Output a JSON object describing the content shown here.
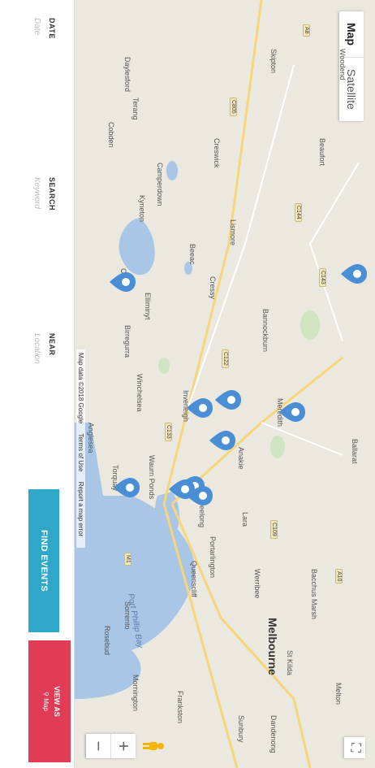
{
  "map": {
    "map_type_tabs": [
      "Map",
      "Satellite"
    ],
    "attribution": [
      "Map data ©2018 Google",
      "Terms of Use",
      "Report a map error"
    ],
    "zoom_in": "+",
    "zoom_out": "−",
    "fullscreen": "⛶",
    "city": "Melbourne",
    "bay": "Port Phillip Bay",
    "places": [
      "Woodend",
      "Daylesford",
      "Kyneton",
      "Creswick",
      "Ballarat",
      "Bacchus Marsh",
      "Melton",
      "Sunbury",
      "Meredith",
      "Geelong",
      "Werribee",
      "Torquay",
      "Anglesea",
      "Winchelsea",
      "Colac",
      "Lara",
      "Queenscliff",
      "Sorrento",
      "Rosebud",
      "Frankston",
      "Mornington",
      "Dandenong",
      "St Kilda",
      "Inverleigh",
      "Anakie",
      "Skipton",
      "Beaufort",
      "Lismore",
      "Cressy",
      "Bannockburn",
      "Camperdown",
      "Cobden",
      "Terang",
      "Elliminyt",
      "Beeac",
      "Birregurra",
      "Waurn Ponds",
      "Portarlington"
    ],
    "pegman": "pegman-icon"
  },
  "search_bar": {
    "date_label": "DATE",
    "date_placeholder": "Date",
    "search_label": "SEARCH",
    "search_placeholder": "Keyword",
    "near_label": "NEAR",
    "near_placeholder": "Location",
    "find_button": "FIND EVENTS",
    "view_as_label": "VIEW AS",
    "view_as_value": "Map"
  },
  "colors": {
    "find_button": "#2fa7c9",
    "view_as": "#e03c55",
    "pin": "#4a8fd6",
    "water": "#a9c6e6"
  }
}
